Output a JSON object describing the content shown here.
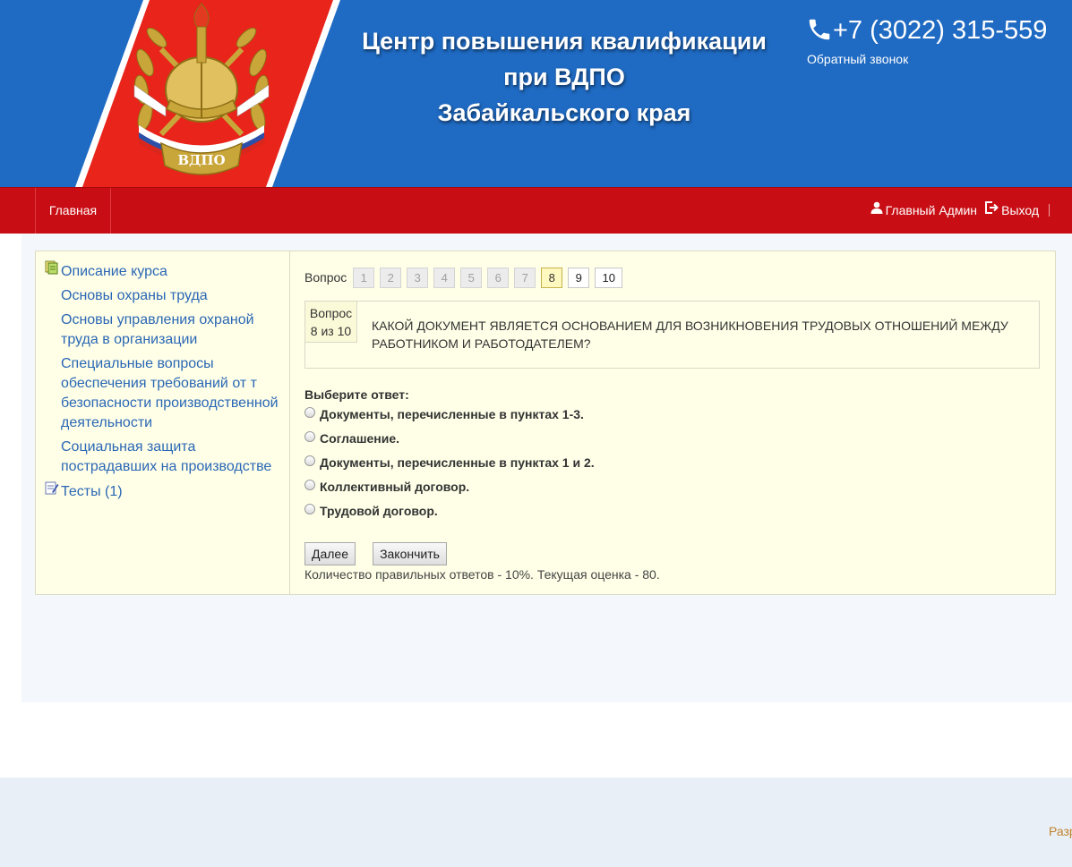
{
  "header": {
    "title_line1": "Центр повышения квалификации",
    "title_line2": "при ВДПО",
    "title_line3": "Забайкальского края",
    "logo_text": "ВДПО",
    "phone": "+7 (3022) 315-559",
    "callback": "Обратный звонок"
  },
  "nav": {
    "home": "Главная",
    "user": "Главный Админ",
    "logout": "Выход"
  },
  "course_tree": {
    "root_label": "Описание курса",
    "items": [
      {
        "label": "Основы охраны труда"
      },
      {
        "label": "Основы управления охраной труда в организации"
      },
      {
        "label": "Специальные вопросы обеспечения требований от т безопасности производственной деятельности"
      },
      {
        "label": "Социальная защита пострадавших на производстве"
      }
    ],
    "tests_label": "Тесты (1)"
  },
  "quiz": {
    "nav_label": "Вопрос",
    "questions": [
      {
        "num": "1",
        "state": "done"
      },
      {
        "num": "2",
        "state": "done"
      },
      {
        "num": "3",
        "state": "done"
      },
      {
        "num": "4",
        "state": "done"
      },
      {
        "num": "5",
        "state": "done"
      },
      {
        "num": "6",
        "state": "done"
      },
      {
        "num": "7",
        "state": "done"
      },
      {
        "num": "8",
        "state": "current"
      },
      {
        "num": "9",
        "state": "pending"
      },
      {
        "num": "10",
        "state": "pending"
      }
    ],
    "counter_line1": "Вопрос",
    "counter_line2": "8 из 10",
    "question_text": "КАКОЙ ДОКУМЕНТ ЯВЛЯЕТСЯ ОСНОВАНИЕМ ДЛЯ ВОЗНИКНОВЕНИЯ ТРУДОВЫХ ОТНОШЕНИЙ МЕЖДУ РАБОТНИКОМ И РАБОТОДАТЕЛЕМ?",
    "answers_title": "Выберите ответ:",
    "answers": [
      {
        "label": "Документы, перечисленные в пунктах 1-3."
      },
      {
        "label": "Соглашение."
      },
      {
        "label": "Документы, перечисленные в пунктах 1 и 2."
      },
      {
        "label": "Коллективный договор."
      },
      {
        "label": "Трудовой договор."
      }
    ],
    "next_button": "Далее",
    "finish_button": "Закончить",
    "stats": "Количество правильных ответов - 10%. Текущая оценка - 80."
  },
  "footer": {
    "dev_text": "Разр"
  },
  "colors": {
    "header_blue": "#1f6ac2",
    "stripe_red": "#e8241b",
    "nav_red": "#c80e14",
    "panel_bg": "#ffffe8",
    "link_blue": "#2a67b4",
    "current_question": "#fff8bf"
  }
}
